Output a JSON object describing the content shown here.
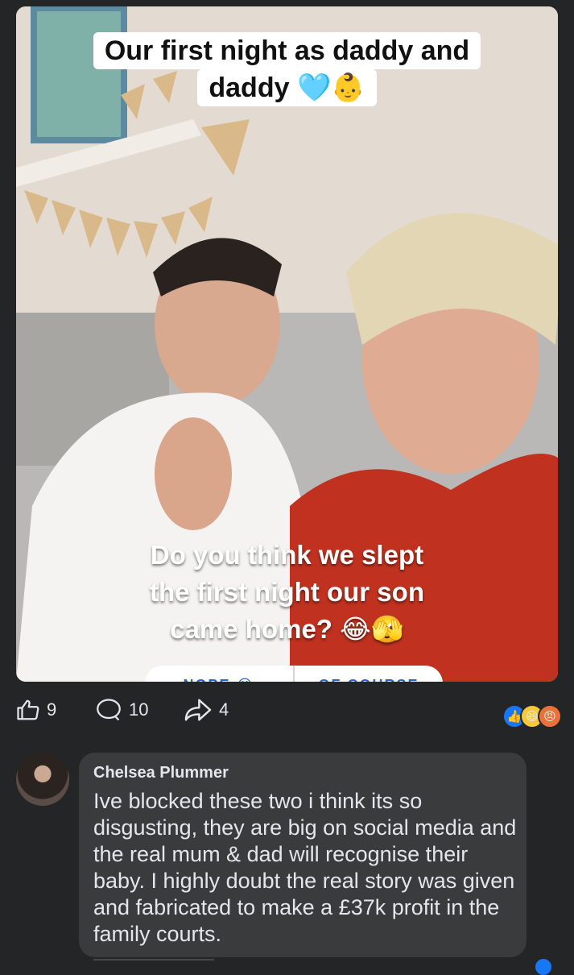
{
  "post": {
    "caption_top": [
      "Our first night as daddy and",
      "daddy 🩵👶"
    ],
    "caption_bottom": [
      "Do you think we slept",
      "the first night our son",
      "came home? 😂🫣"
    ],
    "poll_options": [
      "NOPE 😂",
      "OF COURSE"
    ]
  },
  "actions": {
    "likes": "9",
    "comments": "10",
    "shares": "4",
    "reaction_icons": [
      "like-icon",
      "haha-icon",
      "angry-icon"
    ]
  },
  "comment": {
    "author": "Chelsea Plummer",
    "text": "Ive blocked these two i think its so disgusting, they are big on social media and the real mum & dad will recognise their baby. I highly doubt the real story was given and fabricated to make a £37k profit in the family courts."
  },
  "colors": {
    "background": "#242526",
    "bubble": "#3a3b3c",
    "accent": "#1877f2"
  }
}
